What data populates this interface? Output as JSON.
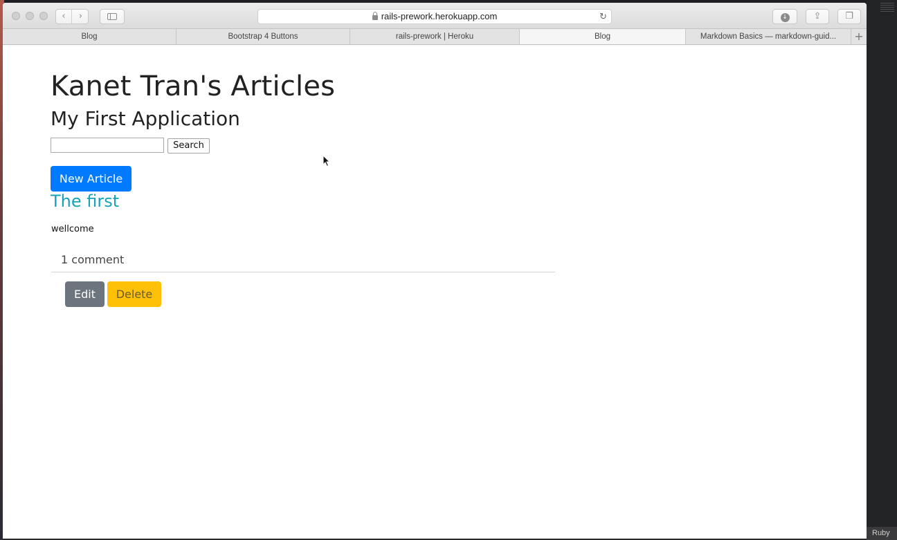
{
  "browser": {
    "url": "rails-prework.herokuapp.com",
    "tabs": [
      {
        "label": "Blog",
        "active": false
      },
      {
        "label": "Bootstrap 4 Buttons",
        "active": false
      },
      {
        "label": "rails-prework | Heroku",
        "active": false
      },
      {
        "label": "Blog",
        "active": true
      },
      {
        "label": "Markdown Basics — markdown-guid...",
        "active": false
      }
    ],
    "new_tab": "+"
  },
  "editor": {
    "status_language": "Ruby"
  },
  "page": {
    "title": "Kanet Tran's Articles",
    "subtitle": "My First Application",
    "search": {
      "value": "",
      "button_label": "Search"
    },
    "new_article_label": "New Article",
    "articles": [
      {
        "title": "The first",
        "body": "wellcome",
        "comments": "1 comment",
        "edit_label": "Edit",
        "delete_label": "Delete"
      }
    ]
  },
  "colors": {
    "primary": "#007bff",
    "info": "#17a2b8",
    "secondary": "#6c757d",
    "warning": "#ffc107"
  }
}
